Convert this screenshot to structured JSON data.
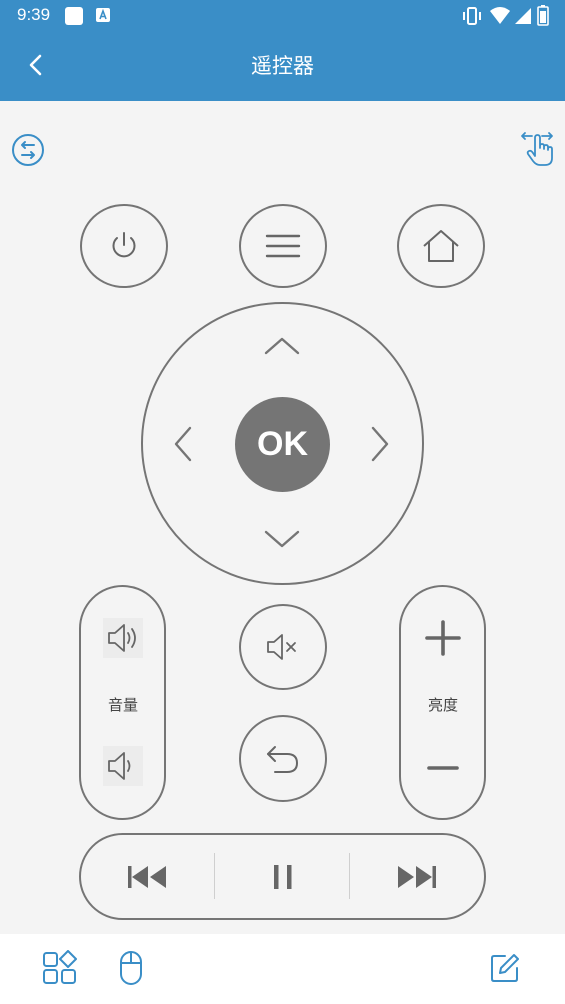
{
  "status_bar": {
    "time": "9:39"
  },
  "header": {
    "title": "遥控器"
  },
  "remote": {
    "ok_label": "OK",
    "volume_label": "音量",
    "brightness_label": "亮度"
  },
  "colors": {
    "header_bg": "#3a8ec7",
    "accent": "#3a8ec7",
    "outline": "#757575",
    "background": "#f4f4f4"
  },
  "icons": {
    "top_left": "switch-device-icon",
    "top_right": "swipe-gesture-icon",
    "bottom": [
      "apps-grid-icon",
      "mouse-icon",
      "edit-icon"
    ]
  }
}
